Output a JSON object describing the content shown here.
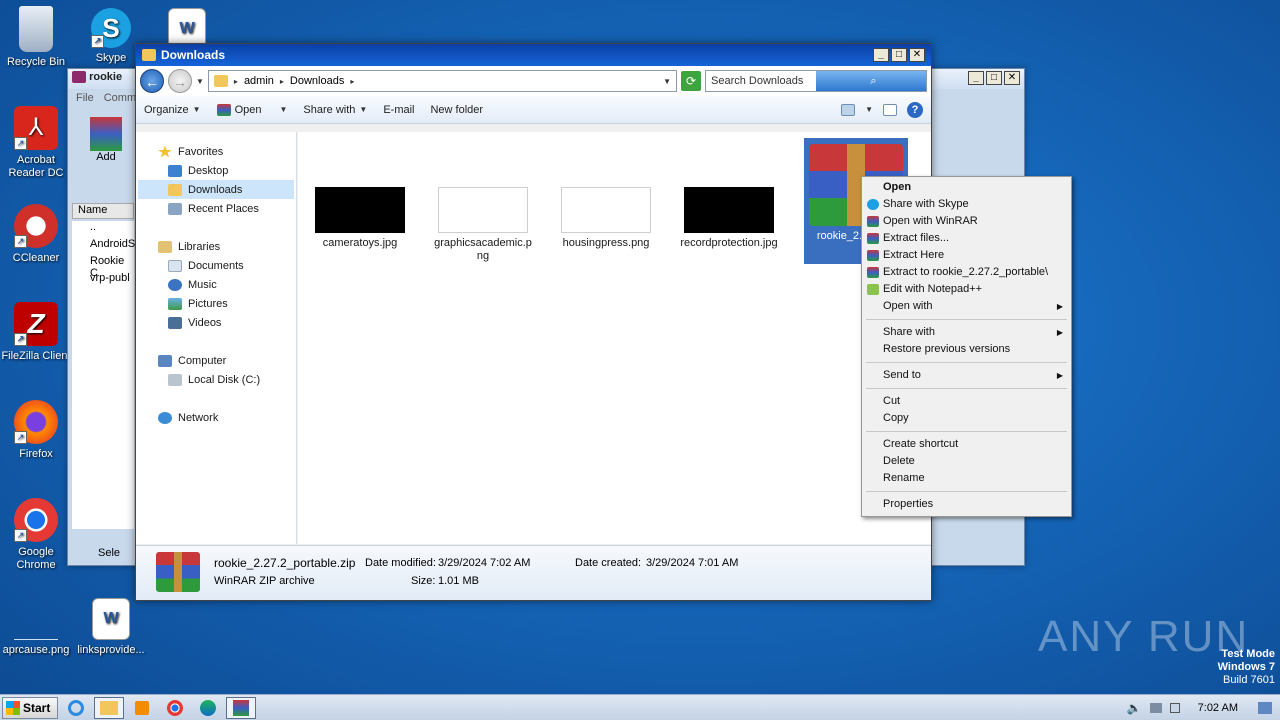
{
  "desktop": {
    "icons": [
      {
        "label": "Recycle Bin"
      },
      {
        "label": "Skype"
      },
      {
        "label": "Acrobat Reader DC"
      },
      {
        "label": "CCleaner"
      },
      {
        "label": "FileZilla Client"
      },
      {
        "label": "Firefox"
      },
      {
        "label": "Google Chrome"
      },
      {
        "label": "aprcause.png"
      },
      {
        "label": "linksprovide..."
      }
    ],
    "watermark": "ANY RUN",
    "test_mode": {
      "line1": "Test Mode",
      "line2": "Windows 7",
      "line3": "Build 7601"
    }
  },
  "back_window": {
    "title": "rookie",
    "menu": [
      "File",
      "Comm"
    ],
    "add_label": "Add",
    "column_name": "Name",
    "rows": [
      "..",
      "AndroidS",
      "Rookie C",
      "vrp-publ"
    ],
    "status": "Sele"
  },
  "window": {
    "title": "Downloads",
    "breadcrumb": [
      "admin",
      "Downloads"
    ],
    "search_placeholder": "Search Downloads",
    "toolbar": {
      "organize": "Organize",
      "open": "Open",
      "share_with": "Share with",
      "email": "E-mail",
      "new_folder": "New folder"
    },
    "nav": {
      "favorites": "Favorites",
      "desktop": "Desktop",
      "downloads": "Downloads",
      "recent": "Recent Places",
      "libraries": "Libraries",
      "documents": "Documents",
      "music": "Music",
      "pictures": "Pictures",
      "videos": "Videos",
      "computer": "Computer",
      "local_disk": "Local Disk (C:)",
      "network": "Network"
    },
    "files": [
      {
        "name": "cameratoys.jpg"
      },
      {
        "name": "graphicsacademic.png"
      },
      {
        "name": "housingpress.png"
      },
      {
        "name": "recordprotection.jpg"
      },
      {
        "name": "rookie_2.27.2_portable.zip",
        "visible": "rookie_2.2 able."
      }
    ],
    "details": {
      "filename": "rookie_2.27.2_portable.zip",
      "type": "WinRAR ZIP archive",
      "modified_label": "Date modified:",
      "modified": "3/29/2024 7:02 AM",
      "created_label": "Date created:",
      "created": "3/29/2024 7:01 AM",
      "size_label": "Size:",
      "size": "1.01 MB"
    }
  },
  "context_menu": {
    "items": [
      {
        "label": "Open"
      },
      {
        "label": "Share with Skype"
      },
      {
        "label": "Open with WinRAR"
      },
      {
        "label": "Extract files..."
      },
      {
        "label": "Extract Here"
      },
      {
        "label": "Extract to rookie_2.27.2_portable\\"
      },
      {
        "label": "Edit with Notepad++"
      },
      {
        "label": "Open with"
      },
      {
        "label": "Share with"
      },
      {
        "label": "Restore previous versions"
      },
      {
        "label": "Send to"
      },
      {
        "label": "Cut"
      },
      {
        "label": "Copy"
      },
      {
        "label": "Create shortcut"
      },
      {
        "label": "Delete"
      },
      {
        "label": "Rename"
      },
      {
        "label": "Properties"
      }
    ]
  },
  "taskbar": {
    "start": "Start",
    "clock": "7:02 AM"
  }
}
